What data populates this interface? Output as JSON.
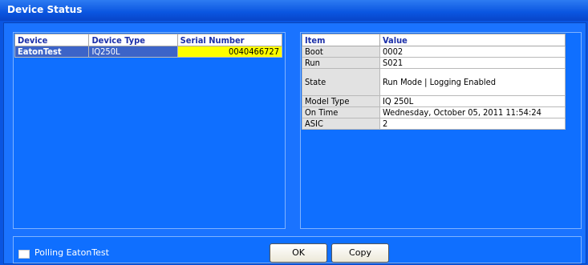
{
  "window": {
    "title": "Device Status"
  },
  "device_table": {
    "headers": [
      "Device",
      "Device Type",
      "Serial Number"
    ],
    "rows": [
      {
        "device": "EatonTest",
        "type": "IQ250L",
        "serial": "0040466727"
      }
    ]
  },
  "info_table": {
    "headers": [
      "Item",
      "Value"
    ],
    "rows": [
      [
        "Boot",
        "0002"
      ],
      [
        "Run",
        "S021"
      ],
      [
        "State",
        "Run Mode | Logging Enabled"
      ],
      [
        "Model Type",
        "IQ 250L"
      ],
      [
        "On Time",
        "Wednesday, October 05, 2011 11:54:24"
      ],
      [
        "ASIC",
        "2"
      ]
    ]
  },
  "footer": {
    "polling_label": "Polling EatonTest",
    "ok_label": "OK",
    "copy_label": "Copy"
  },
  "colors": {
    "background": "#0a55e0",
    "selection": "#3c64c8",
    "serial_highlight": "#ffff00"
  }
}
